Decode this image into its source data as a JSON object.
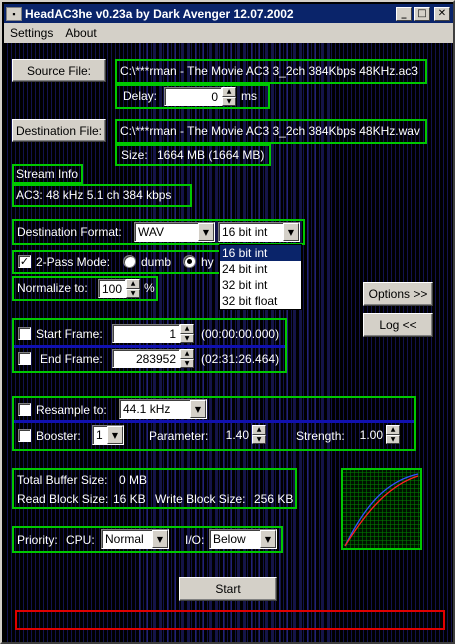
{
  "window": {
    "title": "HeadAC3he v0.23a by Dark Avenger 12.07.2002"
  },
  "menu": [
    "Settings",
    "About"
  ],
  "source": {
    "button": "Source File:",
    "path": "C:\\***rman - The Movie AC3 3_2ch 384Kbps 48KHz.ac3",
    "delay_label": "Delay:",
    "delay_value": "0",
    "delay_unit": "ms"
  },
  "destination": {
    "button": "Destination File:",
    "path": "C:\\***rman - The Movie AC3 3_2ch 384Kbps 48KHz.wav",
    "size_label": "Size:",
    "size_value": "1664 MB  (1664 MB)"
  },
  "stream": {
    "title": "Stream Info",
    "info": "AC3:  48 kHz   5.1 ch    384 kbps"
  },
  "format": {
    "label": "Destination Format:",
    "format_value": "WAV",
    "bits_value": "16 bit int",
    "bits_options": [
      "16 bit int",
      "24 bit int",
      "32 bit int",
      "32 bit float"
    ]
  },
  "twopass": {
    "label": "2-Pass Mode:",
    "checked": "✓",
    "opt1": "dumb",
    "opt2": "hy"
  },
  "normalize": {
    "label": "Normalize to:",
    "value": "100",
    "unit": "%"
  },
  "buttons": {
    "options": "Options >>",
    "log": "Log <<",
    "start": "Start"
  },
  "frames": {
    "start_label": "Start Frame:",
    "start_value": "1",
    "start_time": "(00:00:00.000)",
    "end_label": "End Frame:",
    "end_value": "283952",
    "end_time": "(02:31:26.464)"
  },
  "resample": {
    "label": "Resample to:",
    "value": "44.1 kHz"
  },
  "booster": {
    "label": "Booster:",
    "value": "1",
    "param_label": "Parameter:",
    "param_value": "1.40",
    "strength_label": "Strength:",
    "strength_value": "1.00"
  },
  "buffer": {
    "total_label": "Total Buffer Size:",
    "total_value": "0 MB",
    "read_label": "Read Block Size:",
    "read_value": "16 KB",
    "write_label": "Write Block Size:",
    "write_value": "256 KB"
  },
  "priority": {
    "label": "Priority:",
    "cpu_label": "CPU:",
    "cpu_value": "Normal",
    "io_label": "I/O:",
    "io_value": "Below"
  },
  "colors": {
    "titlebar": "#0a246a",
    "group_border": "#00c800",
    "progress_border": "#e00000",
    "background": "#000000"
  }
}
